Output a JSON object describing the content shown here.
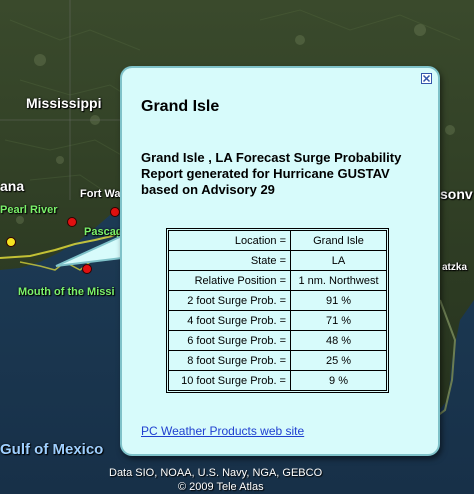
{
  "map": {
    "labels": {
      "mississippi": "Mississippi",
      "ana": "ana",
      "fort_walton": "Fort Walt",
      "pearl_river": "Pearl River",
      "pascagoula": "Pascag",
      "mouth_of_mississippi": "Mouth of the Missi",
      "gulf_of_mexico": "Gulf of Mexico",
      "jacksonville": "sonv",
      "atzka": "atzka"
    },
    "attribution": {
      "data_line": "Data SIO, NOAA, U.S. Navy, NGA, GEBCO",
      "copyright_line": "© 2009 Tele Atlas"
    },
    "colors": {
      "land_dark": "#2e3a22",
      "water": "#1d3a52",
      "marker_red": "#e01010",
      "marker_yellow": "#f4e420"
    }
  },
  "balloon": {
    "title": "Grand Isle",
    "heading": "Grand Isle , LA Forecast Surge Probability Report generated for Hurricane GUSTAV based on Advisory 29",
    "rows": [
      {
        "key": "Location =",
        "value": "Grand Isle"
      },
      {
        "key": "State =",
        "value": "LA"
      },
      {
        "key": "Relative Position =",
        "value": "1 nm. Northwest"
      },
      {
        "key": "2 foot Surge Prob. =",
        "value": "91 %"
      },
      {
        "key": "4 foot Surge Prob. =",
        "value": "71 %"
      },
      {
        "key": "6 foot Surge Prob. =",
        "value": "48 %"
      },
      {
        "key": "8 foot Surge Prob. =",
        "value": "25 %"
      },
      {
        "key": "10 foot Surge Prob. =",
        "value": "9 %"
      }
    ],
    "link_text": "PC Weather Products web site",
    "close_icon": "close-x-icon",
    "colors": {
      "background": "#d7fbfb",
      "border": "#7fc2c9",
      "link": "#1f3fd0"
    }
  }
}
